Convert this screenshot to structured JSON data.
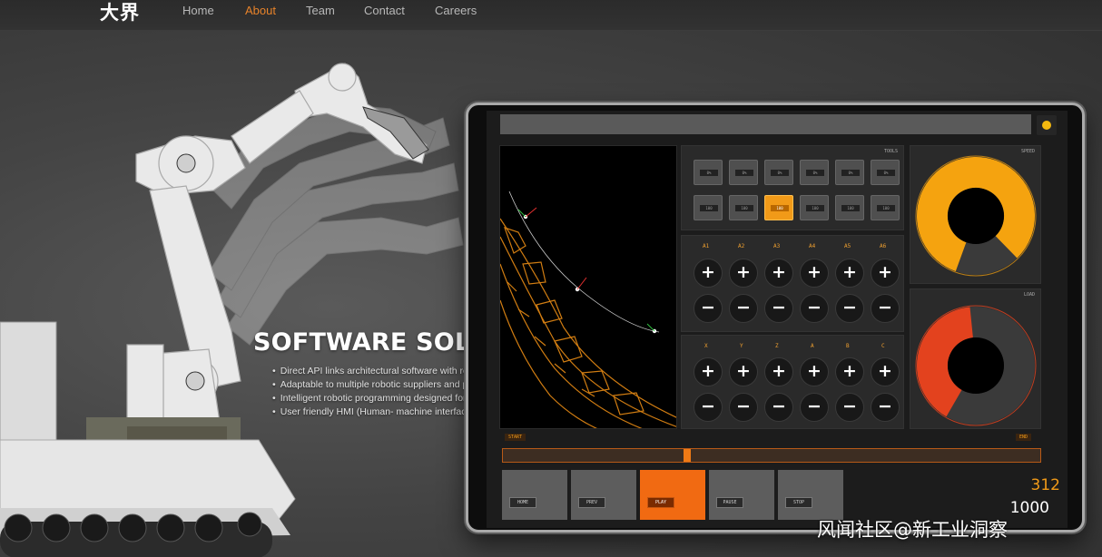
{
  "nav": {
    "logo": "大界",
    "links": [
      {
        "label": "Home",
        "active": false
      },
      {
        "label": "About",
        "active": true
      },
      {
        "label": "Team",
        "active": false
      },
      {
        "label": "Contact",
        "active": false
      },
      {
        "label": "Careers",
        "active": false
      }
    ]
  },
  "hero": {
    "title": "SOFTWARE SOLUTION",
    "bullets": [
      "Direct API links architectural software with robotics",
      "Adaptable to multiple robotic suppliers and platforms",
      "Intelligent robotic programming designed for smart factory",
      "User friendly HMI (Human- machine interface)"
    ]
  },
  "hmi": {
    "tool_panel_tag": "TOOLS",
    "tool_buttons": [
      {
        "label": "0%",
        "active": false
      },
      {
        "label": "0%",
        "active": false
      },
      {
        "label": "0%",
        "active": false
      },
      {
        "label": "0%",
        "active": false
      },
      {
        "label": "0%",
        "active": false
      },
      {
        "label": "0%",
        "active": false
      },
      {
        "label": "100",
        "active": false
      },
      {
        "label": "100",
        "active": false
      },
      {
        "label": "100",
        "active": true
      },
      {
        "label": "100",
        "active": false
      },
      {
        "label": "100",
        "active": false
      },
      {
        "label": "100",
        "active": false
      }
    ],
    "joint_labels": [
      "A1",
      "A2",
      "A3",
      "A4",
      "A5",
      "A6"
    ],
    "linear_labels": [
      "X",
      "Y",
      "Z",
      "A",
      "B",
      "C"
    ],
    "plus_symbol": "+",
    "minus_symbol": "−",
    "gauge_top": {
      "tag": "SPEED",
      "level": 0.82,
      "color": "#f5a30f"
    },
    "gauge_bottom": {
      "tag": "LOAD",
      "level": 0.4,
      "color": "#e3421e"
    },
    "progress": {
      "start_label": "START",
      "end_label": "END",
      "value": 0.34
    },
    "bottom_buttons": [
      {
        "label": "HOME",
        "active": false
      },
      {
        "label": "PREV",
        "active": false
      },
      {
        "label": "PLAY",
        "active": true
      },
      {
        "label": "PAUSE",
        "active": false
      },
      {
        "label": "STOP",
        "active": false
      }
    ],
    "counter_current": "312",
    "counter_total": "1000"
  },
  "watermark": "风闻社区@新工业洞察",
  "colors": {
    "accent": "#f19a18",
    "accent_dark": "#f16a12",
    "gauge_red": "#e3421e"
  }
}
